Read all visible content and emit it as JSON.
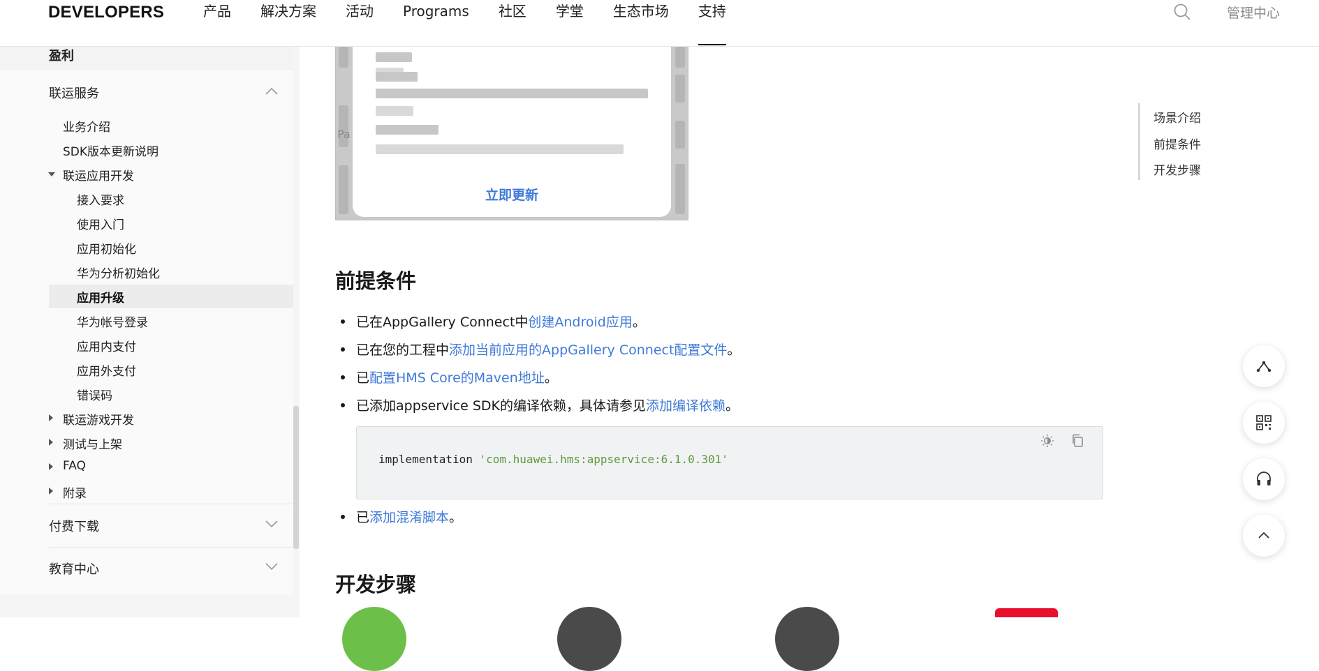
{
  "nav": {
    "brand": "DEVELOPERS",
    "items": [
      "产品",
      "解决方案",
      "活动",
      "Programs",
      "社区",
      "学堂",
      "生态市场",
      "支持"
    ],
    "active_index": 7,
    "admin": "管理中心",
    "search_icon": "search-icon"
  },
  "sidebar": {
    "top_label": "盈利",
    "section_open": "联运服务",
    "items": {
      "intro": "业务介绍",
      "sdk_notes": "SDK版本更新说明",
      "app_dev": "联运应用开发",
      "access_req": "接入要求",
      "getting_started": "使用入门",
      "app_init": "应用初始化",
      "analytics_init": "华为分析初始化",
      "app_upgrade": "应用升级",
      "account_login": "华为帐号登录",
      "iap": "应用内支付",
      "external_pay": "应用外支付",
      "error_codes": "错误码",
      "game_dev": "联运游戏开发",
      "testing": "测试与上架",
      "faq": "FAQ",
      "appendix": "附录"
    },
    "section_paid": "付费下载",
    "section_edu": "教育中心",
    "selected": "应用升级"
  },
  "main": {
    "image": {
      "corner_text": "Pa",
      "update_button": "立即更新"
    },
    "prereq": {
      "heading": "前提条件",
      "b1_pre": "已在AppGallery Connect中",
      "b1_link": "创建Android应用",
      "b1_post": "。",
      "b2_pre": "已在您的工程中",
      "b2_link": "添加当前应用的AppGallery Connect配置文件",
      "b2_post": "。",
      "b3_pre": "已",
      "b3_link": "配置HMS Core的Maven地址",
      "b3_post": "。",
      "b4_pre": "已添加appservice SDK的编译依赖，具体请参见",
      "b4_link": "添加编译依赖",
      "b4_post": "。",
      "code_keyword": "implementation ",
      "code_string": "'com.huawei.hms:appservice:6.1.0.301'",
      "b5_pre": "已",
      "b5_link": "添加混淆脚本",
      "b5_post": "。"
    },
    "steps_heading": "开发步骤"
  },
  "toc": {
    "items": [
      "场景介绍",
      "前提条件",
      "开发步骤"
    ]
  },
  "fabs": [
    "share-icon",
    "qrcode-icon",
    "headset-icon",
    "back-to-top-icon"
  ],
  "colors": {
    "link": "#3f7ad8",
    "code_string": "#5b9a3d",
    "step_green": "#6cc04a",
    "step_dark": "#4a4a4a",
    "step_red": "#e8112d"
  }
}
